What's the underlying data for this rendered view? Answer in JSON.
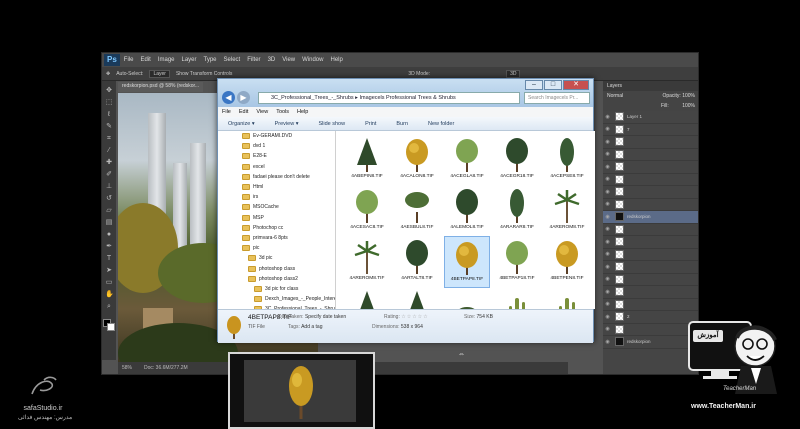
{
  "photoshop": {
    "logo": "Ps",
    "menu": [
      "File",
      "Edit",
      "Image",
      "Layer",
      "Type",
      "Select",
      "Filter",
      "3D",
      "View",
      "Window",
      "Help"
    ],
    "options": {
      "auto_select": "Auto-Select:",
      "auto_select_value": "Layer",
      "transform_controls": "Show Transform Controls",
      "mode_3d": "3D Mode:",
      "workspace": "3D"
    },
    "doc_tab": "redskorpion.psd @ 58% (redskor...",
    "zoom": "58%",
    "doc_size": "Doc: 36.6M/277.2M",
    "layers_panel": {
      "tab": "Layers",
      "blend_mode": "Normal",
      "opacity_label": "Opacity:",
      "opacity": "100%",
      "fill_label": "Fill:",
      "fill": "100%",
      "layers": [
        "Layer 1",
        "7",
        "",
        "",
        "",
        "",
        "",
        "",
        "redskorpion",
        "",
        "",
        "",
        "",
        "",
        "",
        "",
        "2",
        "",
        "redskorpion"
      ],
      "selected_index": 8
    }
  },
  "explorer": {
    "address": "3C_Professional_Trees_-_Shrubs  ▸  Imagecels Professional Trees & Shrubs",
    "search_placeholder": "Search Imagecels Pr...",
    "menu": [
      "File",
      "Edit",
      "View",
      "Tools",
      "Help"
    ],
    "commands": {
      "organize": "Organize ▾",
      "preview": "Preview ▾",
      "slide_show": "Slide show",
      "print": "Print",
      "burn": "Burn",
      "new_folder": "New folder"
    },
    "tree": [
      {
        "label": "Ev-GERAMI.DVD",
        "indent": 0
      },
      {
        "label": "dvd 1",
        "indent": 0
      },
      {
        "label": "E28-E",
        "indent": 0
      },
      {
        "label": "excel",
        "indent": 0
      },
      {
        "label": "fadaei please don't delete",
        "indent": 0
      },
      {
        "label": "Html",
        "indent": 0
      },
      {
        "label": "irs",
        "indent": 0
      },
      {
        "label": "MSOCache",
        "indent": 0
      },
      {
        "label": "MSP",
        "indent": 0
      },
      {
        "label": "Photochop cc",
        "indent": 0
      },
      {
        "label": "primvara-6 8pts",
        "indent": 0
      },
      {
        "label": "pic",
        "indent": 0
      },
      {
        "label": "3d pic",
        "indent": 1
      },
      {
        "label": "photoshop class",
        "indent": 1
      },
      {
        "label": "photoshop class2",
        "indent": 1
      },
      {
        "label": "3d pic for class",
        "indent": 2
      },
      {
        "label": "Dexch_Images_-_People_Intere",
        "indent": 2
      },
      {
        "label": "3C_Professional_Trees_-_Shrub",
        "indent": 2
      },
      {
        "label": "Imagecels Professional Trees",
        "indent": 3,
        "selected": true
      },
      {
        "label": "ImageCels_-_Birds_Eye_View_-",
        "indent": 2
      }
    ],
    "files": [
      {
        "name": "4ABEPIN8.TIF",
        "kind": "conifer"
      },
      {
        "name": "4ACALON8.TIF",
        "kind": "autumn"
      },
      {
        "name": "4ACEGLA8.TIF",
        "kind": "light"
      },
      {
        "name": "4ACEGR18.TIF",
        "kind": "dark"
      },
      {
        "name": "4ACEPSE8.TIF",
        "kind": "tall"
      },
      {
        "name": "4ACESAC8.TIF",
        "kind": "light"
      },
      {
        "name": "4AESBUL8.TIF",
        "kind": "spread"
      },
      {
        "name": "4ALEMOL8.TIF",
        "kind": "dark"
      },
      {
        "name": "4ARARAR8.TIF",
        "kind": "tall"
      },
      {
        "name": "4AREROM8.TIF",
        "kind": "palm"
      },
      {
        "name": "4AREROM8.TIF",
        "kind": "palm"
      },
      {
        "name": "4ARTALT8.TIF",
        "kind": "dark"
      },
      {
        "name": "4BETPAP8.TIF",
        "kind": "autumn",
        "selected": true
      },
      {
        "name": "4BETPAP18.TIF",
        "kind": "light"
      },
      {
        "name": "4BETPEN8.TIF",
        "kind": "autumn"
      },
      {
        "name": "",
        "kind": "conifer"
      },
      {
        "name": "",
        "kind": "conifer"
      },
      {
        "name": "",
        "kind": "shrub"
      },
      {
        "name": "",
        "kind": "cactus"
      },
      {
        "name": "",
        "kind": "cactus"
      }
    ],
    "details": {
      "file_name": "4BETPAP8.TIF",
      "file_type": "TIF File",
      "date_taken_label": "Date taken:",
      "date_taken": "Specify date taken",
      "tags_label": "Tags:",
      "tags": "Add a tag",
      "rating_label": "Rating:",
      "stars": "☆☆☆☆☆",
      "dimensions_label": "Dimensions:",
      "dimensions": "538 x 964",
      "size_label": "Size:",
      "size": "754 KB"
    }
  },
  "branding": {
    "left_logo": "safaStudio.ir",
    "left_sub": "مدرس: مهندس فدائی",
    "right_name": "TeacherMan",
    "right_url": "www.TeacherMan.ir",
    "right_badge": "آموزش"
  },
  "colors": {
    "explorer_blue": "#3a76c4",
    "selection": "#cde6fc",
    "ps_bg": "#535353"
  }
}
